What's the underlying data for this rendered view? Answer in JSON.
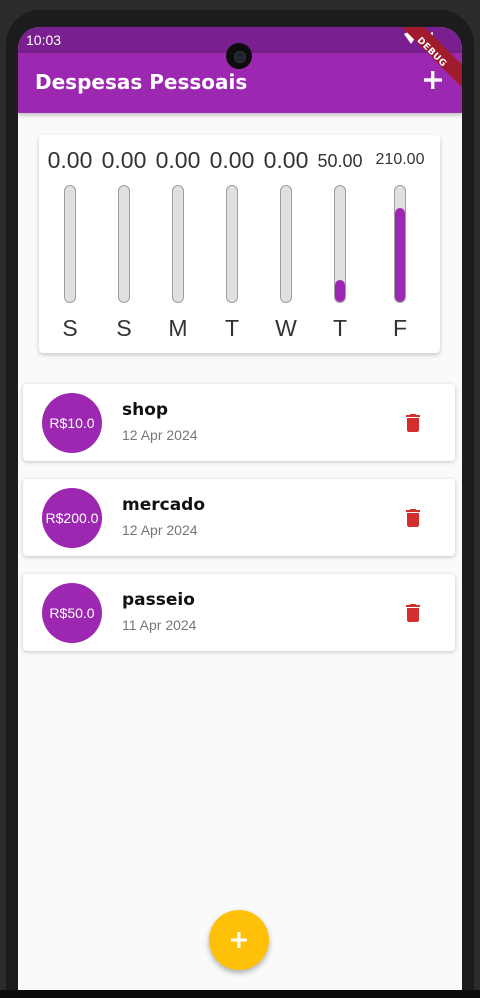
{
  "status_bar": {
    "time": "10:03"
  },
  "app_bar": {
    "title": "Despesas Pessoais",
    "add_icon": "plus-icon"
  },
  "debug_banner": "DEBUG",
  "chart_data": {
    "type": "bar",
    "categories": [
      "S",
      "S",
      "M",
      "T",
      "W",
      "T",
      "F"
    ],
    "values": [
      0.0,
      0.0,
      0.0,
      0.0,
      0.0,
      50.0,
      210.0
    ],
    "labels": [
      "0.00",
      "0.00",
      "0.00",
      "0.00",
      "0.00",
      "50.00",
      "210.00"
    ],
    "fill_fraction": [
      0,
      0,
      0,
      0,
      0,
      0.19,
      0.81
    ],
    "bar_color": "#9c27b0"
  },
  "transactions": [
    {
      "amount": "R$10.0",
      "title": "shop",
      "date": "12 Apr 2024"
    },
    {
      "amount": "R$200.0",
      "title": "mercado",
      "date": "12 Apr 2024"
    },
    {
      "amount": "R$50.0",
      "title": "passeio",
      "date": "11 Apr 2024"
    }
  ],
  "colors": {
    "primary": "#9c27b0",
    "accent": "#ffc107",
    "delete": "#d32f2f",
    "status_bar": "#7a1f8f"
  }
}
